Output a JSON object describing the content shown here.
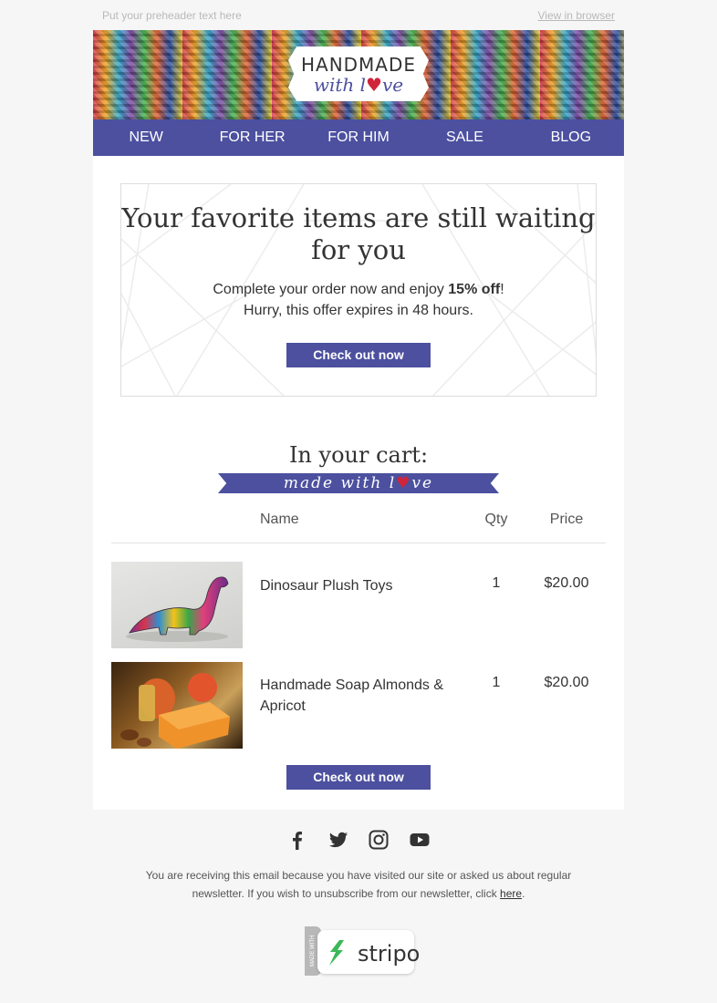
{
  "preheader": {
    "text": "Put your preheader text here",
    "view_in_browser": "View in browser"
  },
  "logo": {
    "line1": "HANDMADE",
    "line2": "with love"
  },
  "nav": {
    "items": [
      "NEW",
      "FOR HER",
      "FOR HIM",
      "SALE",
      "BLOG"
    ]
  },
  "promo": {
    "heading": "Your favorite items are still waiting for you",
    "line1_prefix": "Complete your order now and enjoy ",
    "line1_bold": "15% off",
    "line1_suffix": "!",
    "line2": "Hurry, this offer expires in 48 hours.",
    "button": "Check out now"
  },
  "cart": {
    "title": "In your cart:",
    "ribbon": "made with love",
    "headers": {
      "name": "Name",
      "qty": "Qty",
      "price": "Price"
    },
    "items": [
      {
        "name": "Dinosaur Plush Toys",
        "qty": "1",
        "price": "$20.00",
        "image": "dinosaur-plush-photo"
      },
      {
        "name": "Handmade Soap Almonds & Apricot",
        "qty": "1",
        "price": "$20.00",
        "image": "soap-apricot-photo"
      }
    ],
    "button": "Check out now"
  },
  "social": [
    "facebook-icon",
    "twitter-icon",
    "instagram-icon",
    "youtube-icon"
  ],
  "footer": {
    "text": "You are receiving this email because you have visited our site or asked us about regular newsletter. If you wish to unsubscribe from our newsletter, click ",
    "link": "here",
    "end": "."
  },
  "badge": {
    "side": "MADE WITH",
    "brand": "stripo"
  },
  "colors": {
    "accent": "#4c509f",
    "heart": "#d0243a",
    "background": "#f6f6f6"
  }
}
